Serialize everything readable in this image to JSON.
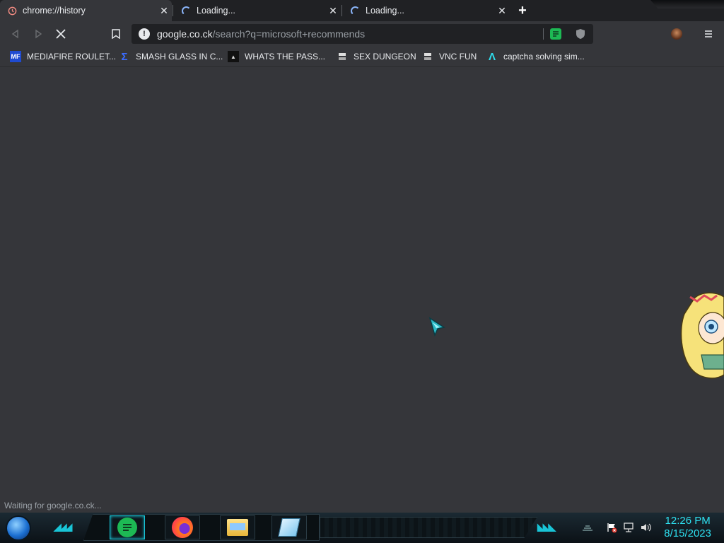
{
  "tabs": [
    {
      "label": "chrome://history",
      "icon": "history-icon",
      "active": true
    },
    {
      "label": "Loading...",
      "icon": "loading-spinner-icon",
      "active": false
    },
    {
      "label": "Loading...",
      "icon": "loading-spinner-icon",
      "active": false
    }
  ],
  "omnibox": {
    "domain": "google.co.ck",
    "path": "/search?q=microsoft+recommends"
  },
  "bookmarks": [
    {
      "label": "MEDIAFIRE ROULET...",
      "icon": "mediafire-icon"
    },
    {
      "label": "SMASH GLASS IN C...",
      "icon": "sigma-icon"
    },
    {
      "label": "WHATS THE PASS...",
      "icon": "terminal-icon"
    },
    {
      "label": "SEX DUNGEON",
      "icon": "server-icon"
    },
    {
      "label": "VNC FUN",
      "icon": "server-icon"
    },
    {
      "label": "captcha solving sim...",
      "icon": "lambda-icon"
    }
  ],
  "status": {
    "text": "Waiting for google.co.ck..."
  },
  "clock": {
    "time": "12:26 PM",
    "date": "8/15/2023"
  },
  "colors": {
    "accent": "#19c4d6",
    "clock": "#2ee0f0",
    "page_bg": "#35363a",
    "tabstrip_bg": "#202124"
  }
}
